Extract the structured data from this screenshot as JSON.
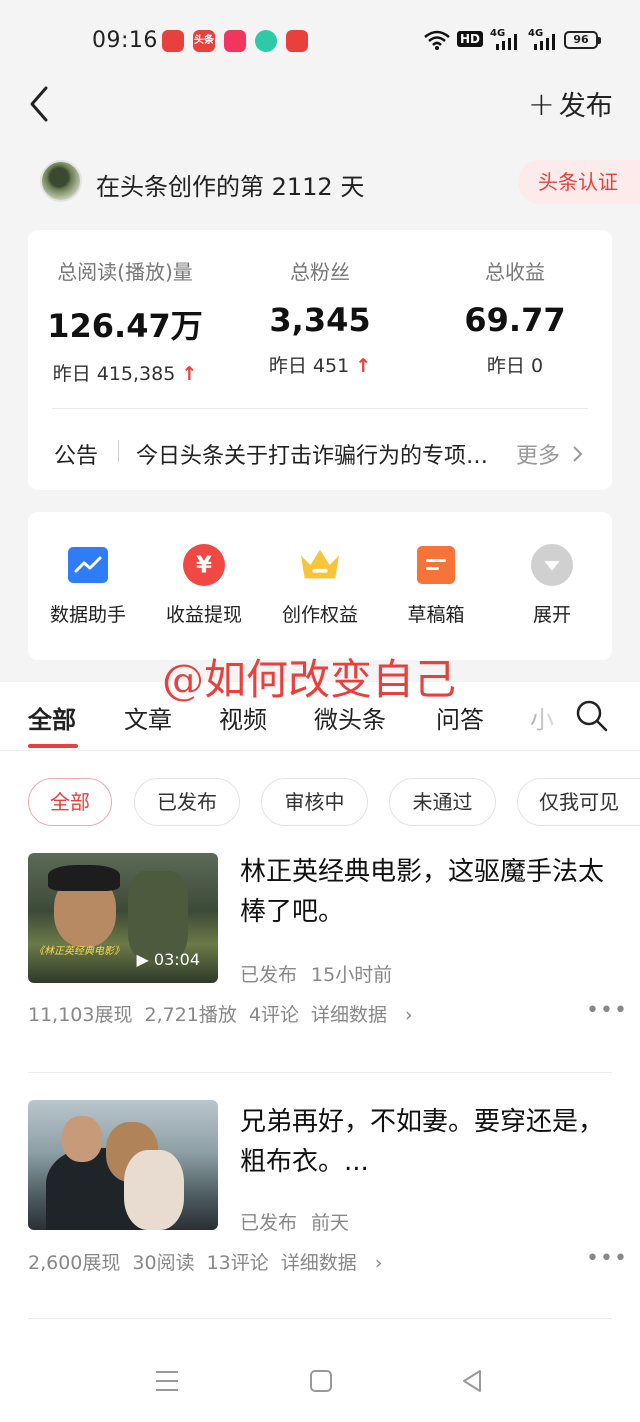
{
  "status_bar": {
    "time": "09:16",
    "app_icon_label": "头条",
    "hd": "HD",
    "network_1": "4G",
    "network_2": "4G",
    "battery": "96"
  },
  "header": {
    "back_icon": "chevron-left-icon",
    "publish_label": "发布"
  },
  "creator": {
    "days_text": "在头条创作的第 2112 天",
    "cert_label": "头条认证"
  },
  "stats": [
    {
      "label": "总阅读(播放)量",
      "value": "126.47万",
      "sub_prefix": "昨日",
      "sub_value": "415,385",
      "trend": "↑"
    },
    {
      "label": "总粉丝",
      "value": "3,345",
      "sub_prefix": "昨日",
      "sub_value": "451",
      "trend": "↑"
    },
    {
      "label": "总收益",
      "value": "69.77",
      "sub_prefix": "昨日",
      "sub_value": "0",
      "trend": ""
    }
  ],
  "notice": {
    "label": "公告",
    "text": "今日头条关于打击诈骗行为的专项治理公告",
    "more": "更多"
  },
  "tools": [
    {
      "label": "数据助手",
      "icon": "chart-icon",
      "color": "#2f7df6"
    },
    {
      "label": "收益提现",
      "icon": "yuan-icon",
      "color": "#f04842"
    },
    {
      "label": "创作权益",
      "icon": "crown-icon",
      "color": "#f7c43a"
    },
    {
      "label": "草稿箱",
      "icon": "draft-icon",
      "color": "#f7733a"
    },
    {
      "label": "展开",
      "icon": "chevron-down-icon",
      "color": "#c8c8c8"
    }
  ],
  "watermark": "@如何改变自己",
  "tabs": [
    "全部",
    "文章",
    "视频",
    "微头条",
    "问答",
    "小"
  ],
  "filters": [
    "全部",
    "已发布",
    "审核中",
    "未通过",
    "仅我可见"
  ],
  "articles": [
    {
      "title": "林正英经典电影，这驱魔手法太棒了吧。",
      "duration": "03:04",
      "thumb_caption": "《林正英经典电影》",
      "status": "已发布",
      "time": "15小时前",
      "impressions": "11,103展现",
      "plays": "2,721播放",
      "comments": "4评论",
      "detail": "详细数据"
    },
    {
      "title": "兄弟再好，不如妻。要穿还是，粗布衣。...",
      "status": "已发布",
      "time": "前天",
      "impressions": "2,600展现",
      "plays": "30阅读",
      "comments": "13评论",
      "detail": "详细数据"
    }
  ]
}
